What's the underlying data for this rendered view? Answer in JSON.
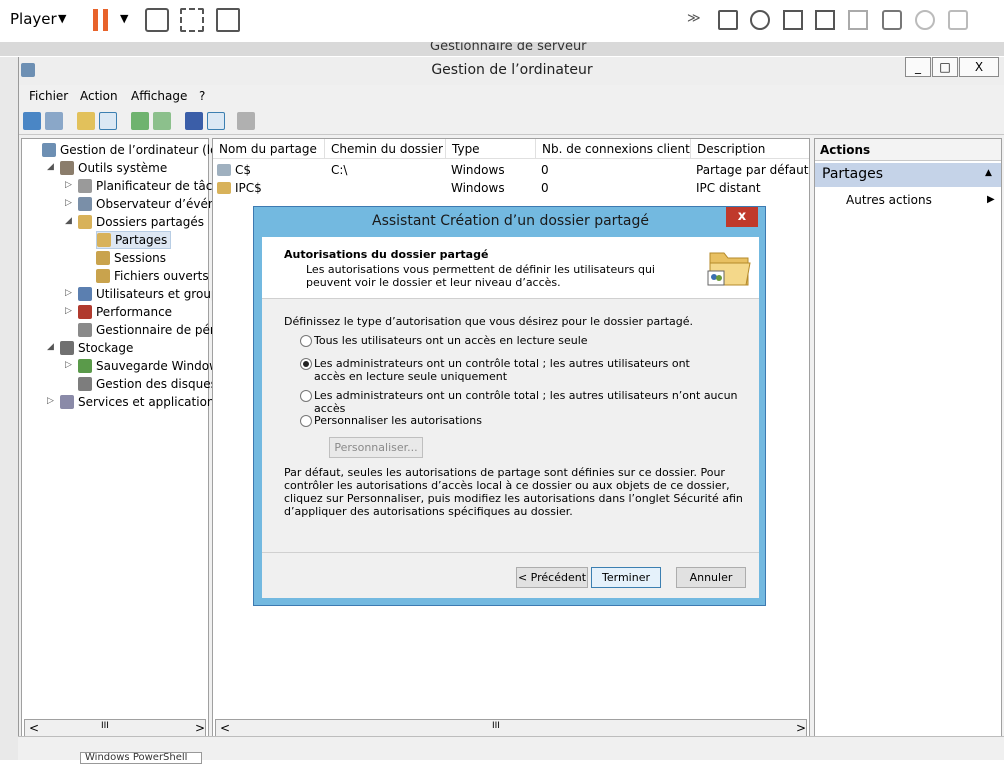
{
  "player": {
    "label": "Player",
    "caret": "▼"
  },
  "server_manager": {
    "title": "Gestionnaire de serveur"
  },
  "window": {
    "title": "Gestion de l’ordinateur",
    "min": "_",
    "max": "□",
    "close": "X"
  },
  "menu": [
    "Fichier",
    "Action",
    "Affichage",
    "?"
  ],
  "tree": [
    {
      "label": "Gestion de l’ordinateur (local)",
      "level": 0,
      "icon": "computer-icon"
    },
    {
      "label": "Outils système",
      "level": 1,
      "icon": "tools-icon",
      "expander": "◢"
    },
    {
      "label": "Planificateur de tâches",
      "level": 2,
      "icon": "clock-icon",
      "expander": "▷"
    },
    {
      "label": "Observateur d’événeme",
      "level": 2,
      "icon": "event-viewer-icon",
      "expander": "▷"
    },
    {
      "label": "Dossiers partagés",
      "level": 2,
      "icon": "shared-folder-icon",
      "expander": "◢"
    },
    {
      "label": "Partages",
      "level": 3,
      "icon": "shares-icon",
      "selected": true
    },
    {
      "label": "Sessions",
      "level": 3,
      "icon": "sessions-icon"
    },
    {
      "label": "Fichiers ouverts",
      "level": 3,
      "icon": "open-files-icon"
    },
    {
      "label": "Utilisateurs et groupes l",
      "level": 2,
      "icon": "users-icon",
      "expander": "▷"
    },
    {
      "label": "Performance",
      "level": 2,
      "icon": "performance-icon",
      "expander": "▷"
    },
    {
      "label": "Gestionnaire de périphé",
      "level": 2,
      "icon": "device-manager-icon"
    },
    {
      "label": "Stockage",
      "level": 1,
      "icon": "storage-icon",
      "expander": "◢"
    },
    {
      "label": "Sauvegarde Windows Se",
      "level": 2,
      "icon": "backup-icon",
      "expander": "▷"
    },
    {
      "label": "Gestion des disques",
      "level": 2,
      "icon": "disk-icon"
    },
    {
      "label": "Services et applications",
      "level": 1,
      "icon": "services-icon",
      "expander": "▷"
    }
  ],
  "list": {
    "columns": [
      "Nom du partage",
      "Chemin du dossier",
      "Type",
      "Nb. de connexions client",
      "Description"
    ],
    "rows": [
      {
        "name": "C$",
        "path": "C:\\",
        "type": "Windows",
        "connections": "0",
        "description": "Partage par défaut"
      },
      {
        "name": "IPC$",
        "path": "",
        "type": "Windows",
        "connections": "0",
        "description": "IPC distant"
      }
    ]
  },
  "actions": {
    "header": "Actions",
    "section": "Partages",
    "items": [
      "Autres actions"
    ]
  },
  "dialog": {
    "title": "Assistant Création d’un dossier partagé",
    "close": "x",
    "header_title": "Autorisations du dossier partagé",
    "header_desc": "Les autorisations vous permettent de définir les utilisateurs qui peuvent voir le dossier et leur niveau d’accès.",
    "prompt": "Définissez le type d’autorisation que vous désirez pour le dossier partagé.",
    "options": [
      {
        "label": "Tous les utilisateurs ont un accès en lecture seule",
        "selected": false
      },
      {
        "label": "Les administrateurs ont un contrôle total ; les autres utilisateurs ont accès en lecture seule uniquement",
        "selected": true
      },
      {
        "label": "Les administrateurs ont un contrôle total ; les autres utilisateurs n’ont aucun accès",
        "selected": false
      },
      {
        "label": "Personnaliser les autorisations",
        "selected": false
      }
    ],
    "customize_button": "Personnaliser...",
    "note": "Par défaut, seules les autorisations de partage sont définies sur ce dossier. Pour contrôler les autorisations d’accès local à ce dossier ou aux objets de ce dossier, cliquez sur Personnaliser, puis modifiez les autorisations dans l’onglet Sécurité afin d’appliquer des autorisations spécifiques au dossier.",
    "buttons": {
      "back": "< Précédent",
      "finish": "Terminer",
      "cancel": "Annuler"
    }
  },
  "scroll": {
    "grip": "III",
    "left": "<",
    "right": ">"
  },
  "taskbar": {
    "powershell": "Windows PowerShell"
  }
}
